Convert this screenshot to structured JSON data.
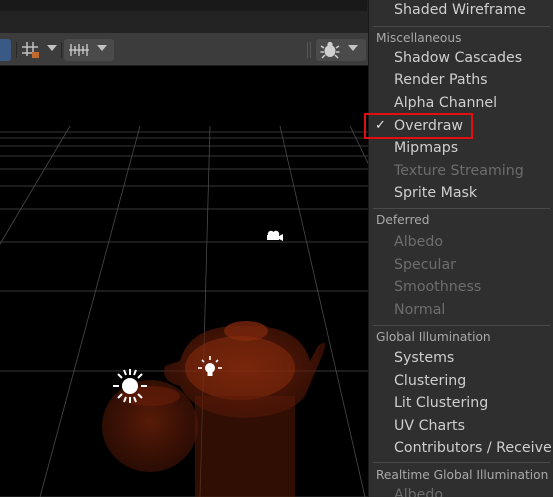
{
  "menu": {
    "top_item": "Shaded Wireframe",
    "sections": [
      {
        "header": "Miscellaneous",
        "items": [
          {
            "label": "Shadow Cascades",
            "enabled": true,
            "checked": false
          },
          {
            "label": "Render Paths",
            "enabled": true,
            "checked": false
          },
          {
            "label": "Alpha Channel",
            "enabled": true,
            "checked": false
          },
          {
            "label": "Overdraw",
            "enabled": true,
            "checked": true
          },
          {
            "label": "Mipmaps",
            "enabled": true,
            "checked": false
          },
          {
            "label": "Texture Streaming",
            "enabled": false,
            "checked": false
          },
          {
            "label": "Sprite Mask",
            "enabled": true,
            "checked": false
          }
        ]
      },
      {
        "header": "Deferred",
        "items": [
          {
            "label": "Albedo",
            "enabled": false,
            "checked": false
          },
          {
            "label": "Specular",
            "enabled": false,
            "checked": false
          },
          {
            "label": "Smoothness",
            "enabled": false,
            "checked": false
          },
          {
            "label": "Normal",
            "enabled": false,
            "checked": false
          }
        ]
      },
      {
        "header": "Global Illumination",
        "items": [
          {
            "label": "Systems",
            "enabled": true,
            "checked": false
          },
          {
            "label": "Clustering",
            "enabled": true,
            "checked": false
          },
          {
            "label": "Lit Clustering",
            "enabled": true,
            "checked": false
          },
          {
            "label": "UV Charts",
            "enabled": true,
            "checked": false
          },
          {
            "label": "Contributors / Receivers",
            "enabled": true,
            "checked": false
          }
        ]
      },
      {
        "header": "Realtime Global Illumination",
        "items": [
          {
            "label": "Albedo",
            "enabled": false,
            "checked": false
          }
        ]
      }
    ],
    "check_mark": "✓"
  },
  "colors": {
    "highlight_border": "#e01010",
    "menu_bg": "#2f2f2f",
    "toolbar_bg": "#3c3c3c",
    "overdraw_tint": "#6b1e08"
  },
  "toolbar": {
    "icons": [
      "grid-snap-icon",
      "ruler-icon",
      "gizmos-bug-icon"
    ]
  }
}
